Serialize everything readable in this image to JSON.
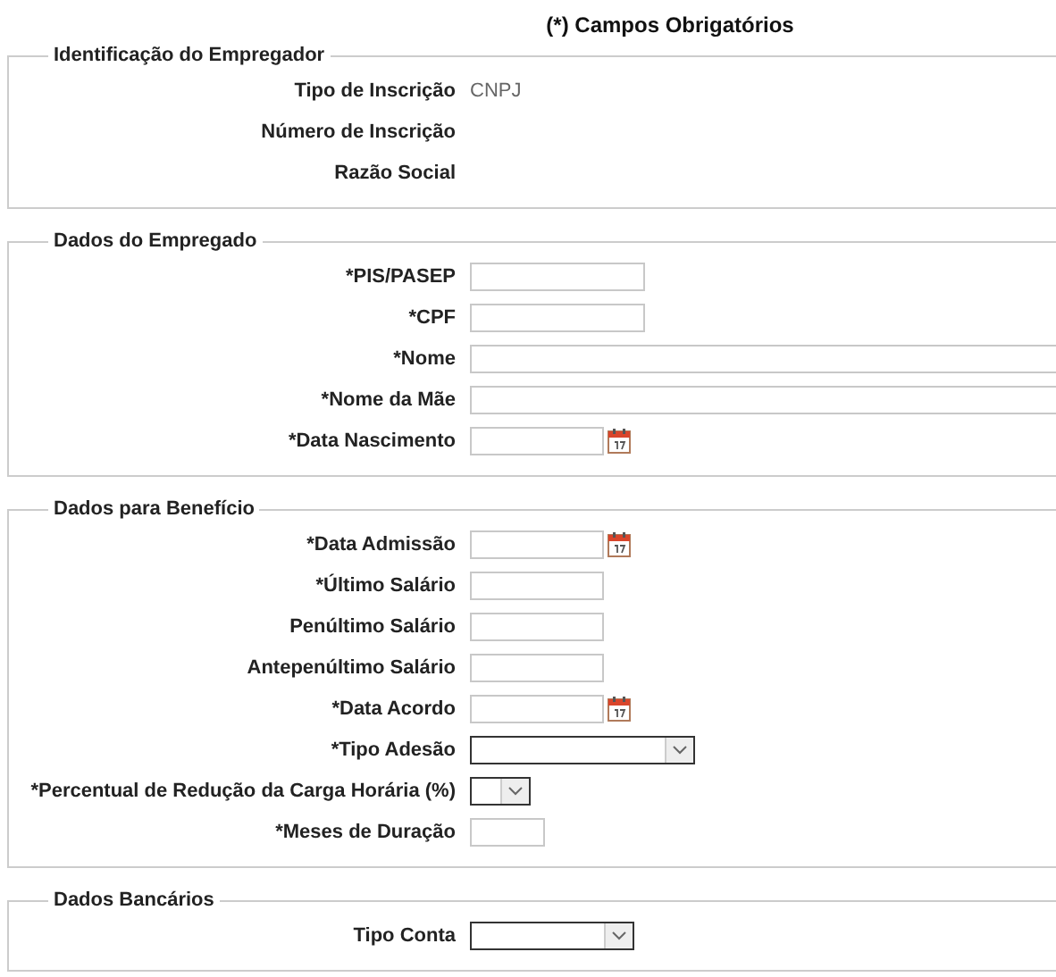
{
  "header": {
    "title": "(*) Campos Obrigatórios"
  },
  "sections": [
    {
      "legend": "Identificação do Empregador",
      "fields": [
        {
          "label": "Tipo de Inscrição",
          "kind": "static",
          "value": "CNPJ"
        },
        {
          "label": "Número de Inscrição",
          "kind": "static"
        },
        {
          "label": "Razão Social",
          "kind": "static"
        }
      ]
    },
    {
      "legend": "Dados do Empregado",
      "fields": [
        {
          "label": "*PIS/PASEP",
          "kind": "idtext"
        },
        {
          "label": "*CPF",
          "kind": "idtext"
        },
        {
          "label": "*Nome",
          "kind": "longtext"
        },
        {
          "label": "*Nome da Mãe",
          "kind": "longtext"
        },
        {
          "label": "*Data Nascimento",
          "kind": "date"
        }
      ]
    },
    {
      "legend": "Dados para Benefício",
      "fields": [
        {
          "label": "*Data Admissão",
          "kind": "date"
        },
        {
          "label": "*Último Salário",
          "kind": "shorttext"
        },
        {
          "label": "Penúltimo Salário",
          "kind": "shorttext"
        },
        {
          "label": "Antepenúltimo Salário",
          "kind": "shorttext"
        },
        {
          "label": "*Data Acordo",
          "kind": "date"
        },
        {
          "label": "*Tipo Adesão",
          "kind": "wideselect"
        },
        {
          "label": "*Percentual de Redução da Carga Horária (%)",
          "kind": "tinyselect"
        },
        {
          "label": "*Meses de Duração",
          "kind": "tinytext"
        }
      ]
    },
    {
      "legend": "Dados Bancários",
      "fields": [
        {
          "label": "Tipo Conta",
          "kind": "select"
        }
      ]
    }
  ]
}
